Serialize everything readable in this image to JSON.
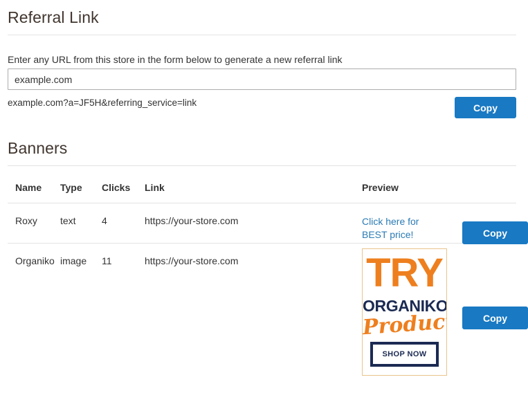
{
  "referral": {
    "title": "Referral Link",
    "hint": "Enter any URL from this store in the form below to generate a new referral link",
    "input_value": "example.com",
    "input_placeholder": "example.com",
    "generated_link": "example.com?a=JF5H&referring_service=link",
    "copy_label": "Copy"
  },
  "banners": {
    "title": "Banners",
    "columns": [
      "Name",
      "Type",
      "Clicks",
      "Link",
      "Preview",
      ""
    ],
    "rows": [
      {
        "name": "Roxy",
        "type": "text",
        "clicks": "4",
        "link": "https://your-store.com",
        "preview_kind": "text",
        "preview_text": "Click here for BEST price!",
        "copy_label": "Copy"
      },
      {
        "name": "Organiko",
        "type": "image",
        "clicks": "11",
        "link": "https://your-store.com",
        "preview_kind": "image",
        "banner": {
          "line1": "TRY",
          "line2": "ORGANIKO",
          "line3": "Products",
          "cta": "SHOP NOW"
        },
        "copy_label": "Copy"
      }
    ]
  },
  "colors": {
    "accent_blue": "#1979c3",
    "link_blue": "#2b7bb4",
    "banner_orange": "#ee7f1e",
    "banner_navy": "#1b2a52",
    "banner_border": "#e8c48c",
    "rule_gray": "#e3e3e3",
    "heading_gray": "#41362f"
  }
}
